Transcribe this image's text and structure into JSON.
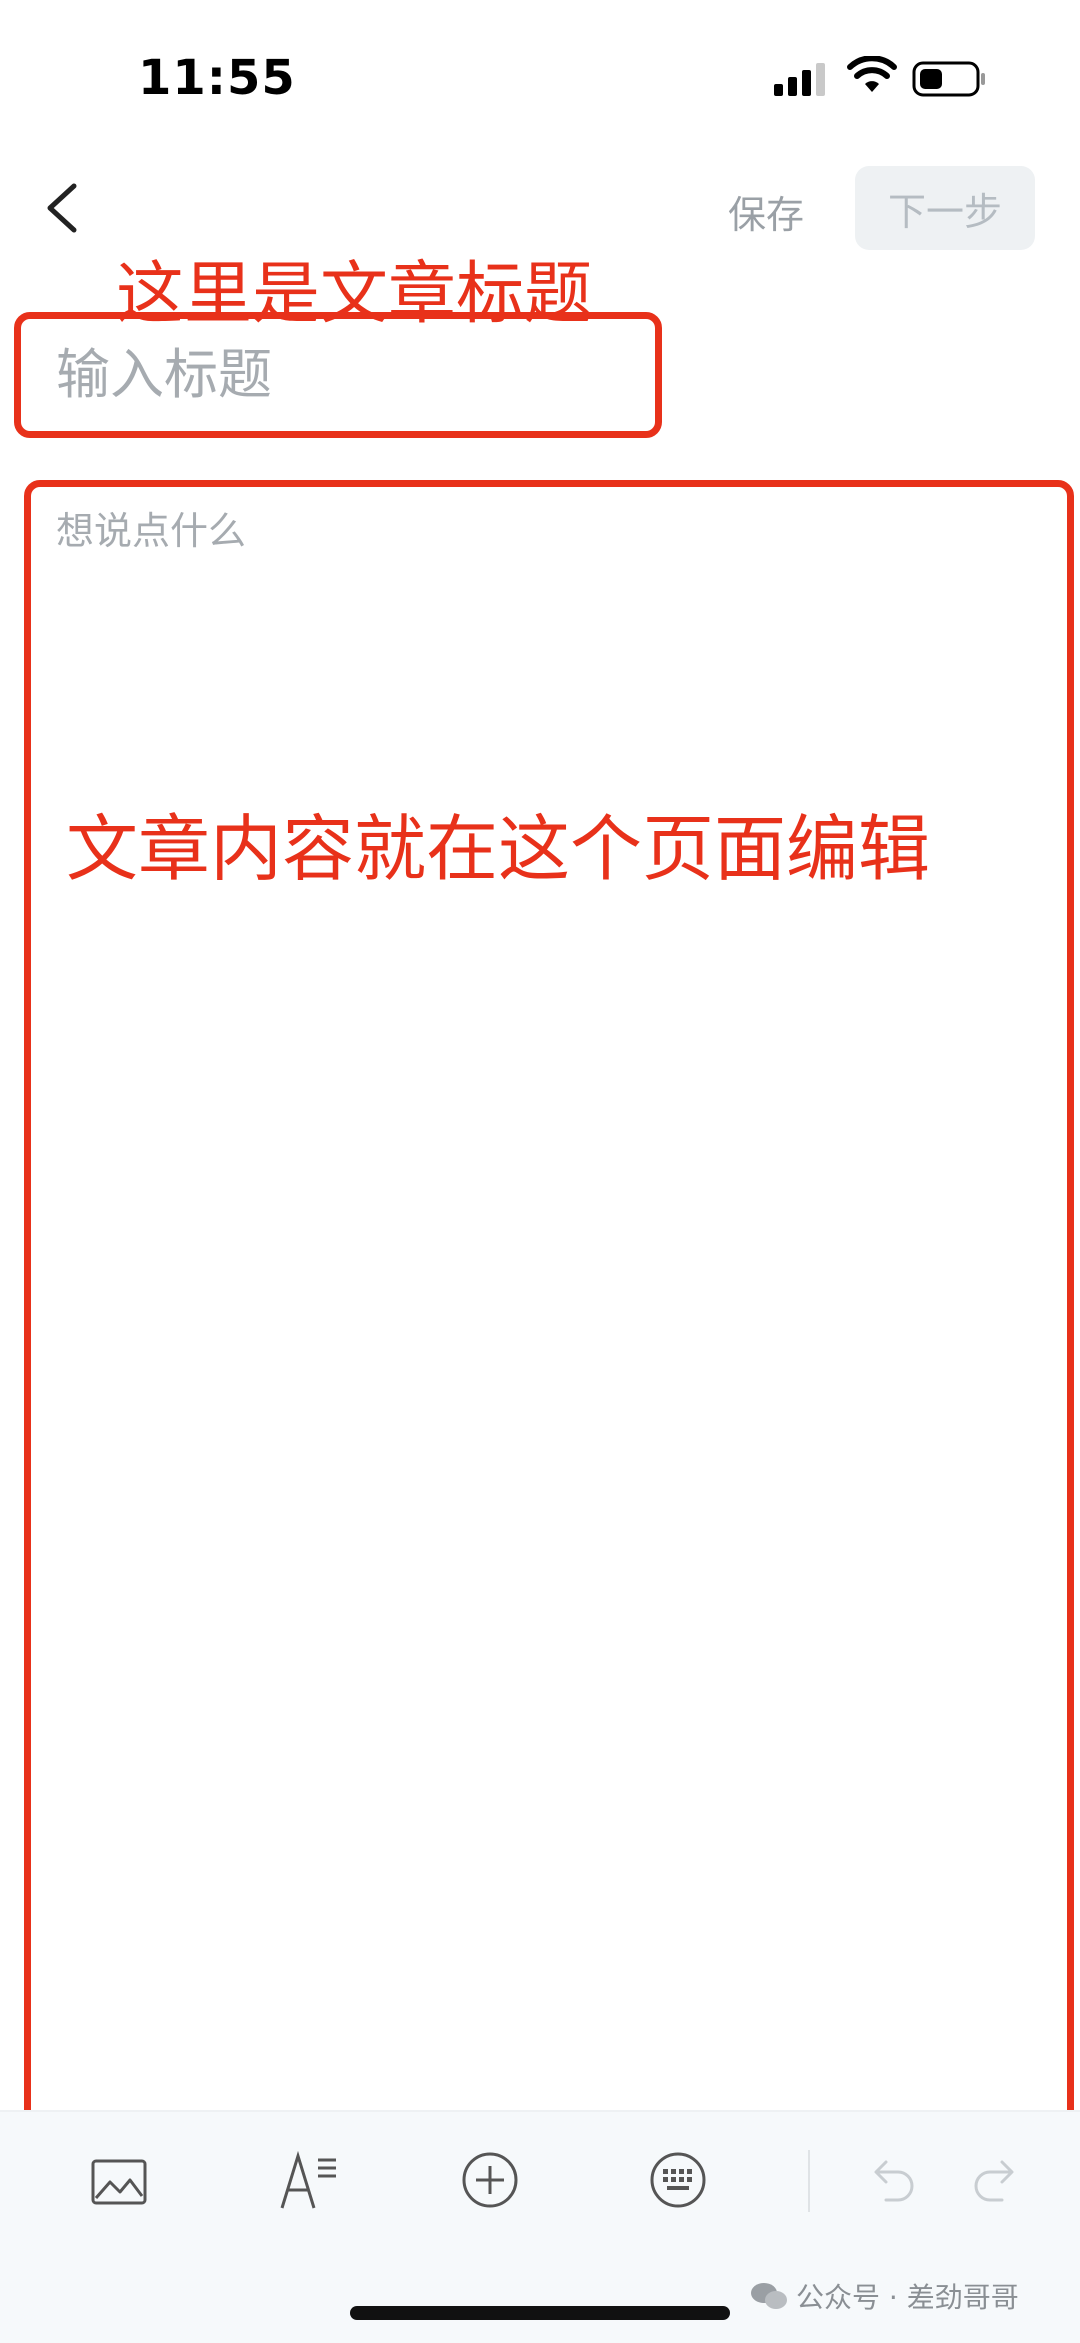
{
  "status_bar": {
    "time": "11:55"
  },
  "nav": {
    "save_label": "保存",
    "next_label": "下一步"
  },
  "editor": {
    "title_placeholder": "输入标题",
    "body_placeholder": "想说点什么"
  },
  "annotations": {
    "title_note": "这里是文章标题",
    "body_note": "文章内容就在这个页面编辑",
    "color": "#e8311a"
  },
  "toolbar": {
    "icons": [
      "image-icon",
      "text-format-icon",
      "add-circle-icon",
      "keyboard-icon",
      "undo-icon",
      "redo-icon"
    ]
  },
  "watermark": {
    "text": "公众号 · 差劲哥哥"
  }
}
